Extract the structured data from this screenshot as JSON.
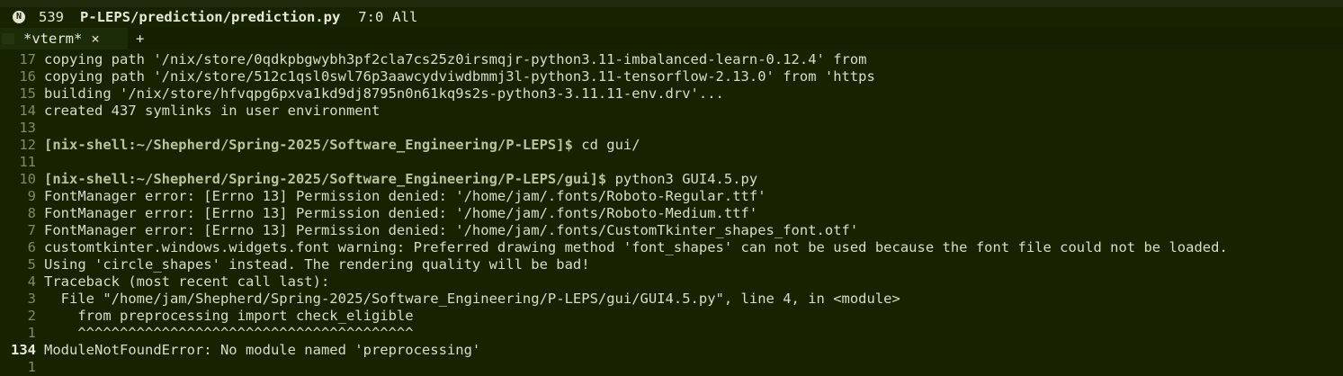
{
  "modeline": {
    "badge": "N",
    "line_number": "539",
    "file": "P-LEPS/prediction/prediction.py",
    "position": "7:0",
    "scroll": "All"
  },
  "tabs": {
    "active_label": "*vterm*",
    "close_glyph": "×",
    "add_glyph": "+"
  },
  "terminal": {
    "rows": [
      {
        "num": "17",
        "prompt": "",
        "text": "copying path '/nix/store/0qdkpbgwybh3pf2cla7cs25z0irsmqjr-python3.11-imbalanced-learn-0.12.4' from"
      },
      {
        "num": "16",
        "prompt": "",
        "text": "copying path '/nix/store/512c1qsl0swl76p3aawcydviwdbmmj3l-python3.11-tensorflow-2.13.0' from 'https"
      },
      {
        "num": "15",
        "prompt": "",
        "text": "building '/nix/store/hfvqpg6pxva1kd9dj8795n0n61kq9s2s-python3-3.11.11-env.drv'..."
      },
      {
        "num": "14",
        "prompt": "",
        "text": "created 437 symlinks in user environment"
      },
      {
        "num": "13",
        "prompt": "",
        "text": ""
      },
      {
        "num": "12",
        "prompt": "[nix-shell:~/Shepherd/Spring-2025/Software_Engineering/P-LEPS]$",
        "text": " cd gui/"
      },
      {
        "num": "11",
        "prompt": "",
        "text": ""
      },
      {
        "num": "10",
        "prompt": "[nix-shell:~/Shepherd/Spring-2025/Software_Engineering/P-LEPS/gui]$",
        "text": " python3 GUI4.5.py"
      },
      {
        "num": "9",
        "prompt": "",
        "text": "FontManager error: [Errno 13] Permission denied: '/home/jam/.fonts/Roboto-Regular.ttf'"
      },
      {
        "num": "8",
        "prompt": "",
        "text": "FontManager error: [Errno 13] Permission denied: '/home/jam/.fonts/Roboto-Medium.ttf'"
      },
      {
        "num": "7",
        "prompt": "",
        "text": "FontManager error: [Errno 13] Permission denied: '/home/jam/.fonts/CustomTkinter_shapes_font.otf'"
      },
      {
        "num": "6",
        "prompt": "",
        "text": "customtkinter.windows.widgets.font warning: Preferred drawing method 'font_shapes' can not be used because the font file could not be loaded."
      },
      {
        "num": "5",
        "prompt": "",
        "text": "Using 'circle_shapes' instead. The rendering quality will be bad!"
      },
      {
        "num": "4",
        "prompt": "",
        "text": "Traceback (most recent call last):"
      },
      {
        "num": "3",
        "prompt": "",
        "text": "  File \"/home/jam/Shepherd/Spring-2025/Software_Engineering/P-LEPS/gui/GUI4.5.py\", line 4, in <module>"
      },
      {
        "num": "2",
        "prompt": "",
        "text": "    from preprocessing import check_eligible"
      },
      {
        "num": "1",
        "prompt": "",
        "text": "    ^^^^^^^^^^^^^^^^^^^^^^^^^^^^^^^^^^^^^^^^"
      },
      {
        "num": "134",
        "prompt": "",
        "text": "ModuleNotFoundError: No module named 'preprocessing'",
        "current": true
      },
      {
        "num": "1",
        "prompt": "",
        "text": ""
      }
    ]
  }
}
